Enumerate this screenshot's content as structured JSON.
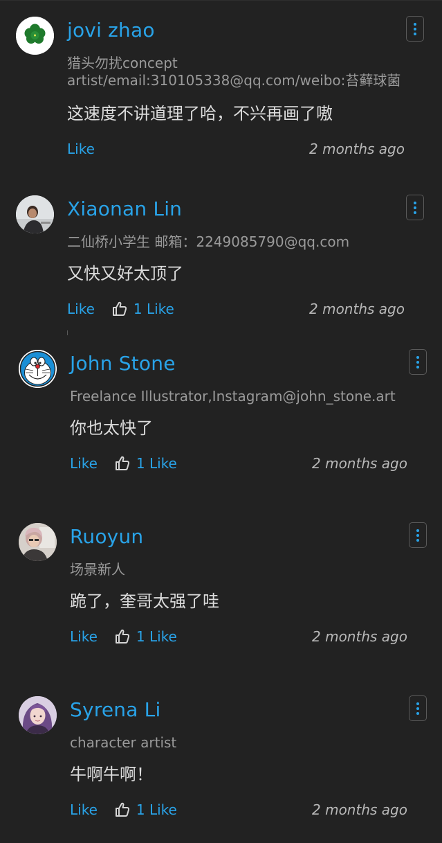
{
  "comments": [
    {
      "name": "jovi zhao",
      "bio": "猎头勿扰concept\nartist/email:310105338@qq.com/weibo:苔藓球菌",
      "text": "这速度不讲道理了哈，不兴再画了嗷",
      "like_label": "Like",
      "like_count_label": "",
      "time": "2 months ago",
      "avatar_icon": "green-clover-avatar-icon"
    },
    {
      "name": "Xiaonan Lin",
      "bio": "二仙桥小学生 邮箱：2249085790@qq.com",
      "text": "又快又好太顶了",
      "like_label": "Like",
      "like_count_label": "1 Like",
      "time": "2 months ago",
      "avatar_icon": "photo-avatar-icon"
    },
    {
      "name": "John Stone",
      "bio": "Freelance Illustrator,Instagram@john_stone.art",
      "text": "你也太快了",
      "like_label": "Like",
      "like_count_label": "1 Like",
      "time": "2 months ago",
      "avatar_icon": "doraemon-avatar-icon"
    },
    {
      "name": "Ruoyun",
      "bio": "场景新人",
      "text": "跪了，奎哥太强了哇",
      "like_label": "Like",
      "like_count_label": "1 Like",
      "time": "2 months ago",
      "avatar_icon": "photo-avatar-icon"
    },
    {
      "name": "Syrena Li",
      "bio": "character artist",
      "text": "牛啊牛啊！",
      "like_label": "Like",
      "like_count_label": "1 Like",
      "time": "2 months ago",
      "avatar_icon": "illustrated-avatar-icon"
    }
  ],
  "colors": {
    "background": "#222222",
    "accent": "#29a3e8",
    "muted_text": "#9a9a9a",
    "body_text": "#dcdcdc"
  }
}
